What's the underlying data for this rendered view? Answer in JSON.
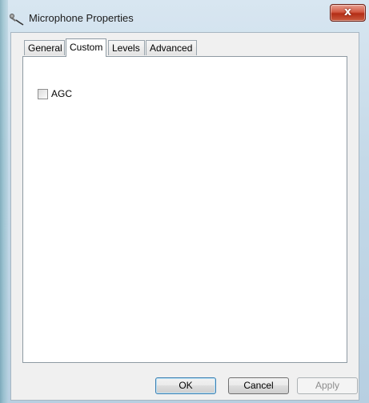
{
  "window": {
    "title": "Microphone Properties",
    "close_label": "x"
  },
  "tabs": [
    {
      "label": "General",
      "active": false
    },
    {
      "label": "Custom",
      "active": true
    },
    {
      "label": "Levels",
      "active": false
    },
    {
      "label": "Advanced",
      "active": false
    }
  ],
  "custom_panel": {
    "agc": {
      "label": "AGC",
      "checked": false
    }
  },
  "buttons": {
    "ok_label": "OK",
    "cancel_label": "Cancel",
    "apply_label": "Apply"
  },
  "colors": {
    "close_button": "#d35a43",
    "default_button_border": "#3c7fb1"
  }
}
